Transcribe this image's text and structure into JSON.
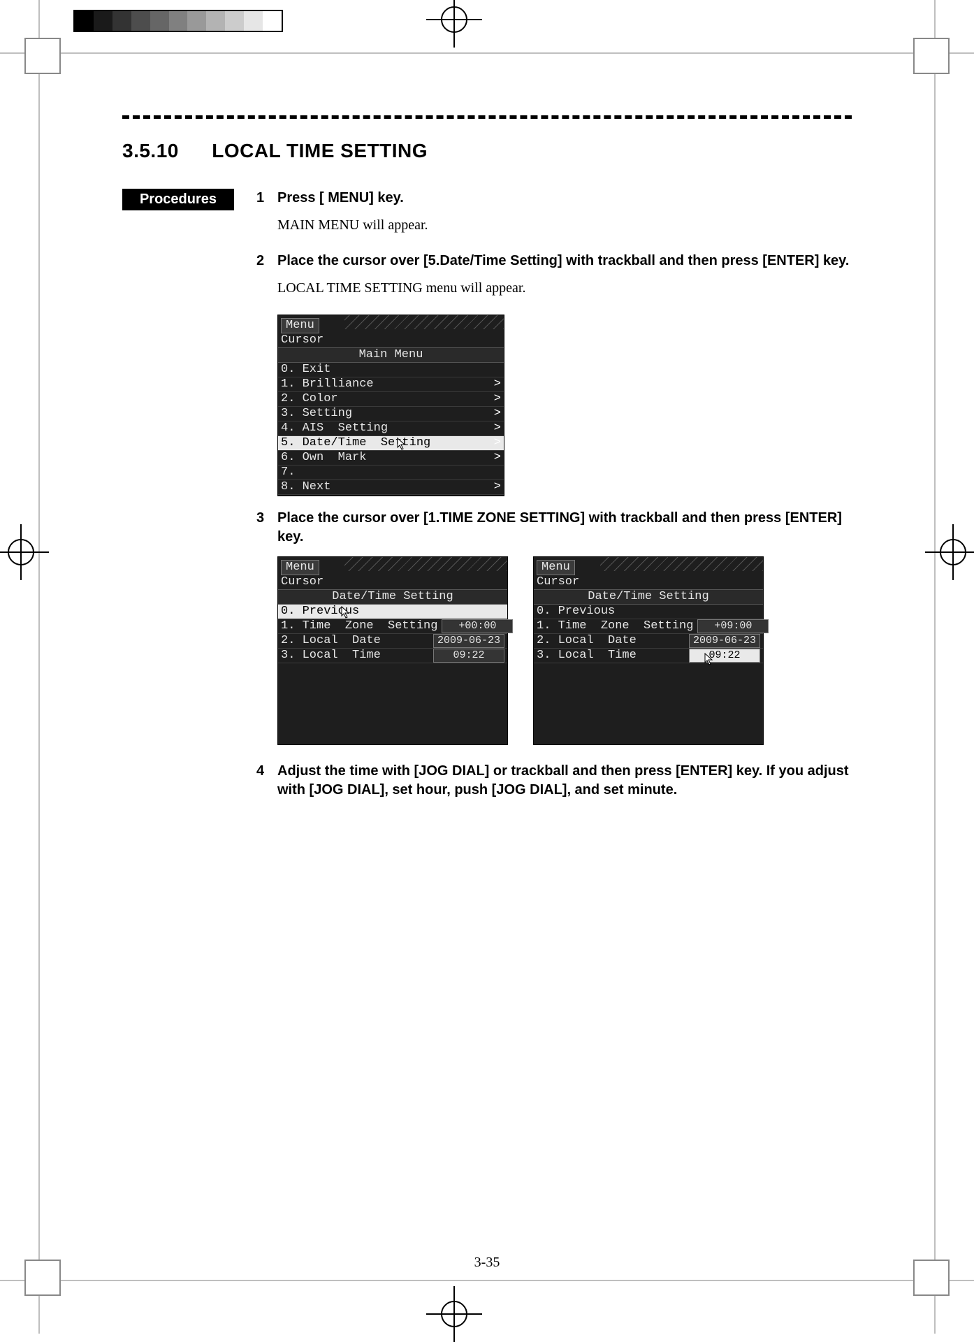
{
  "section": {
    "number": "3.5.10",
    "title": "LOCAL TIME SETTING"
  },
  "procedures_label": "Procedures",
  "steps": {
    "s1": {
      "num": "1",
      "text": "Press [ MENU] key.",
      "note": "MAIN MENU will appear."
    },
    "s2": {
      "num": "2",
      "text": "Place the cursor over [5.Date/Time Setting] with trackball and then press [ENTER] key.",
      "note": "LOCAL TIME SETTING menu will appear."
    },
    "s3": {
      "num": "3",
      "text": "Place the cursor over [1.TIME ZONE SETTING] with trackball and then press [ENTER] key."
    },
    "s4": {
      "num": "4",
      "text": "Adjust the time with [JOG DIAL] or trackball and then press [ENTER] key. If you adjust with [JOG DIAL], set hour, push [JOG DIAL], and set minute."
    }
  },
  "panel_main": {
    "menu_btn": "Menu",
    "cursor": "Cursor",
    "title": "Main  Menu",
    "items": [
      {
        "label": "0. Exit",
        "chev": ""
      },
      {
        "label": "1. Brilliance",
        "chev": ">"
      },
      {
        "label": "2. Color",
        "chev": ">"
      },
      {
        "label": "3. Setting",
        "chev": ">"
      },
      {
        "label": "4. AIS  Setting",
        "chev": ">"
      },
      {
        "label": "5. Date/Time  Setting",
        "chev": ">",
        "selected": true
      },
      {
        "label": "6. Own  Mark",
        "chev": ">"
      },
      {
        "label": "7.",
        "chev": ""
      },
      {
        "label": "8. Next",
        "chev": ">"
      }
    ]
  },
  "panel_dt_a": {
    "menu_btn": "Menu",
    "cursor": "Cursor",
    "title": "Date/Time  Setting",
    "items": [
      {
        "label": "0. Previous",
        "selected_label": true
      },
      {
        "label": "1. Time  Zone  Setting",
        "val": "+00:00"
      },
      {
        "label": "2. Local  Date",
        "val": "2009-06-23"
      },
      {
        "label": "3. Local  Time",
        "val": "09:22"
      }
    ]
  },
  "panel_dt_b": {
    "menu_btn": "Menu",
    "cursor": "Cursor",
    "title": "Date/Time  Setting",
    "items": [
      {
        "label": "0. Previous"
      },
      {
        "label": "1. Time  Zone  Setting",
        "val": "+09:00"
      },
      {
        "label": "2. Local  Date",
        "val": "2009-06-23"
      },
      {
        "label": "3. Local  Time",
        "val": "09:22",
        "selected_val": true
      }
    ]
  },
  "page_number": "3-35"
}
